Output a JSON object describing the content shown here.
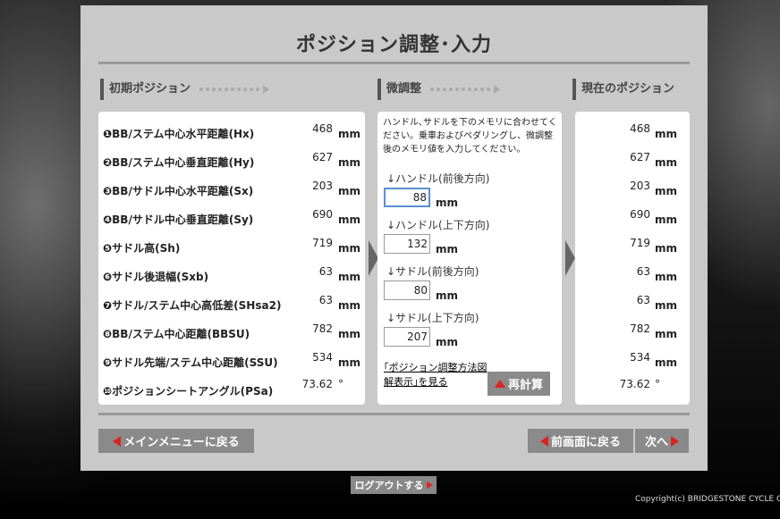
{
  "page_title": "ポジション調整･入力",
  "columns": {
    "initial": "初期ポジション",
    "fine": "微調整",
    "current": "現在のポジション"
  },
  "unit_mm": "mm",
  "unit_deg": "°",
  "initial_rows": [
    {
      "label": "❶BB/ステム中心水平距離(Hx)",
      "value": "468"
    },
    {
      "label": "❷BB/ステム中心垂直距離(Hy)",
      "value": "627"
    },
    {
      "label": "❸BB/サドル中心水平距離(Sx)",
      "value": "203"
    },
    {
      "label": "❹BB/サドル中心垂直距離(Sy)",
      "value": "690"
    },
    {
      "label": "❺サドル高(Sh)",
      "value": "719"
    },
    {
      "label": "❻サドル後退幅(Sxb)",
      "value": "63"
    },
    {
      "label": "❼サドル/ステム中心高低差(SHsa2)",
      "value": "63"
    },
    {
      "label": "❽BB/ステム中心距離(BBSU)",
      "value": "782"
    },
    {
      "label": "❾サドル先端/ステム中心距離(SSU)",
      "value": "534"
    },
    {
      "label": "❿ポジションシートアングル(PSa)",
      "value": "73.62"
    }
  ],
  "fine": {
    "description": "ハンドル､サドルを下のメモリに合わせてください。乗車およびペダリングし、微調整後のメモリ値を入力してください。",
    "inputs": [
      {
        "label": "↓ハンドル(前後方向)",
        "value": "88"
      },
      {
        "label": "↓ハンドル(上下方向)",
        "value": "132"
      },
      {
        "label": "↓サドル(前後方向)",
        "value": "80"
      },
      {
        "label": "↓サドル(上下方向)",
        "value": "207"
      }
    ],
    "link_text": "｢ポジション調整方法図解表示｣を見る",
    "recalc_label": "再計算"
  },
  "current_values": [
    "468",
    "627",
    "203",
    "690",
    "719",
    "63",
    "63",
    "782",
    "534",
    "73.62"
  ],
  "buttons": {
    "main_menu": "メインメニューに戻る",
    "prev": "前画面に戻る",
    "next": "次へ",
    "logout": "ログアウトする"
  },
  "copyright": "Copyright(c) BRIDGESTONE CYCLE C",
  "colors": {
    "accent_red": "#dd2222",
    "button_gray": "#8a8a8a",
    "panel": "#c9c9c9"
  }
}
